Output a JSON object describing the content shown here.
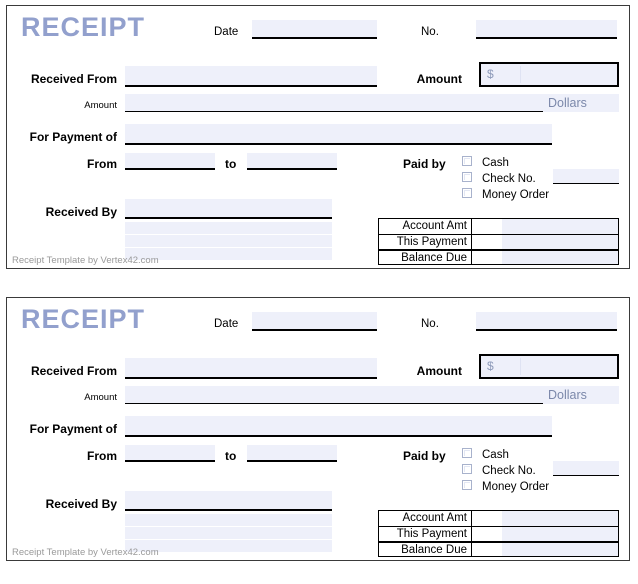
{
  "document": {
    "title": "RECEIPT",
    "footer_text": "Receipt Template by Vertex42.com",
    "copies": 2
  },
  "colors": {
    "title_blue": "#92a0cd",
    "field_fill": "#eef0fa",
    "rule_black": "#000000",
    "muted_text": "#7b88aa",
    "footer_gray": "#9a9a9a"
  },
  "fields": {
    "date_label": "Date",
    "date_value": "",
    "no_label": "No.",
    "no_value": "",
    "received_from_label": "Received From",
    "received_from_value": "",
    "amount_words_label": "Amount",
    "amount_words_value": "",
    "dollars_label": "Dollars",
    "for_payment_of_label": "For Payment of",
    "for_payment_of_value": "",
    "from_label": "From",
    "from_value": "",
    "to_label": "to",
    "to_value": "",
    "received_by_label": "Received By",
    "received_by_value": "",
    "amount_label": "Amount",
    "amount_currency_symbol": "$",
    "amount_value": ""
  },
  "paid_by": {
    "label": "Paid by",
    "options": [
      {
        "label": "Cash",
        "checked": false,
        "has_input": false,
        "value": ""
      },
      {
        "label": "Check No.",
        "checked": false,
        "has_input": true,
        "value": ""
      },
      {
        "label": "Money Order",
        "checked": false,
        "has_input": false,
        "value": ""
      }
    ]
  },
  "totals": {
    "rows": [
      {
        "label": "Account Amt",
        "value": ""
      },
      {
        "label": "This Payment",
        "value": ""
      },
      {
        "label": "Balance Due",
        "value": ""
      }
    ]
  }
}
